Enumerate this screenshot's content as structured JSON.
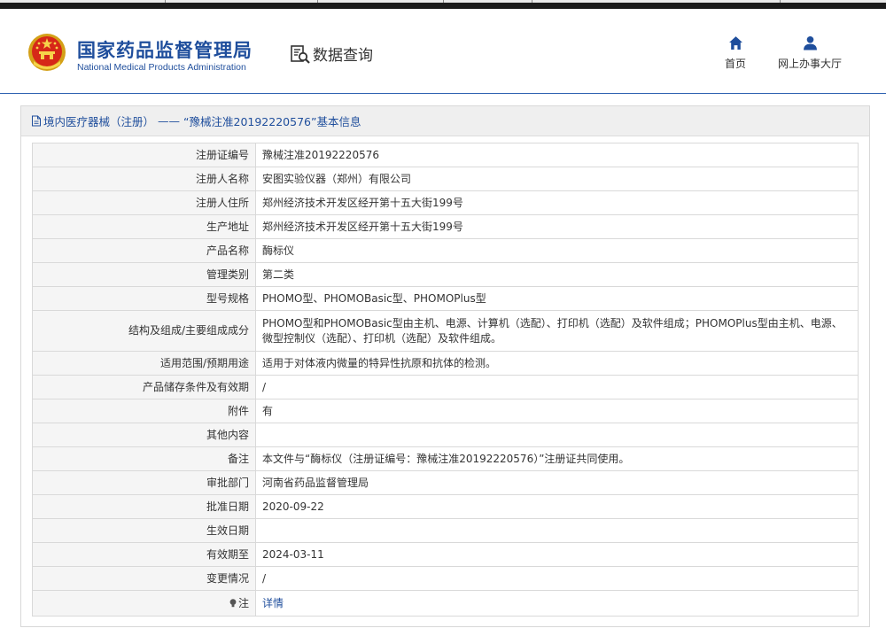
{
  "header": {
    "org_cn": "国家药品监督管理局",
    "org_en": "National Medical Products Administration",
    "query_label": "数据查询",
    "nav": {
      "home": "首页",
      "hall": "网上办事大厅"
    }
  },
  "panel": {
    "breadcrumb_category": "境内医疗器械（注册）",
    "breadcrumb_separator": "——",
    "breadcrumb_record": "“豫械注准20192220576”基本信息"
  },
  "rows": [
    {
      "label": "注册证编号",
      "value": "豫械注准20192220576"
    },
    {
      "label": "注册人名称",
      "value": "安图实验仪器（郑州）有限公司"
    },
    {
      "label": "注册人住所",
      "value": "郑州经济技术开发区经开第十五大街199号"
    },
    {
      "label": "生产地址",
      "value": "郑州经济技术开发区经开第十五大街199号"
    },
    {
      "label": "产品名称",
      "value": "酶标仪"
    },
    {
      "label": "管理类别",
      "value": "第二类"
    },
    {
      "label": "型号规格",
      "value": "PHOMO型、PHOMOBasic型、PHOMOPlus型"
    },
    {
      "label": "结构及组成/主要组成成分",
      "value": "PHOMO型和PHOMOBasic型由主机、电源、计算机（选配）、打印机（选配）及软件组成；PHOMOPlus型由主机、电源、微型控制仪（选配）、打印机（选配）及软件组成。"
    },
    {
      "label": "适用范围/预期用途",
      "value": "适用于对体液内微量的特异性抗原和抗体的检测。"
    },
    {
      "label": "产品储存条件及有效期",
      "value": "/"
    },
    {
      "label": "附件",
      "value": "有"
    },
    {
      "label": "其他内容",
      "value": ""
    },
    {
      "label": "备注",
      "value": "本文件与“酶标仪（注册证编号：豫械注准20192220576）”注册证共同使用。"
    },
    {
      "label": "审批部门",
      "value": "河南省药品监督管理局"
    },
    {
      "label": "批准日期",
      "value": "2020-09-22"
    },
    {
      "label": "生效日期",
      "value": ""
    },
    {
      "label": "有效期至",
      "value": "2024-03-11"
    },
    {
      "label": "变更情况",
      "value": "/"
    }
  ],
  "note_row": {
    "label": "注",
    "link_text": "详情"
  },
  "colors": {
    "brand_blue": "#1f4e9c",
    "header_rule": "#2f63b1",
    "label_bg": "#f5f5f5",
    "title_bg": "#efefef"
  },
  "icons": [
    "emblem-icon",
    "magnifier-document-icon",
    "home-icon",
    "user-icon",
    "document-icon",
    "bulb-icon"
  ]
}
